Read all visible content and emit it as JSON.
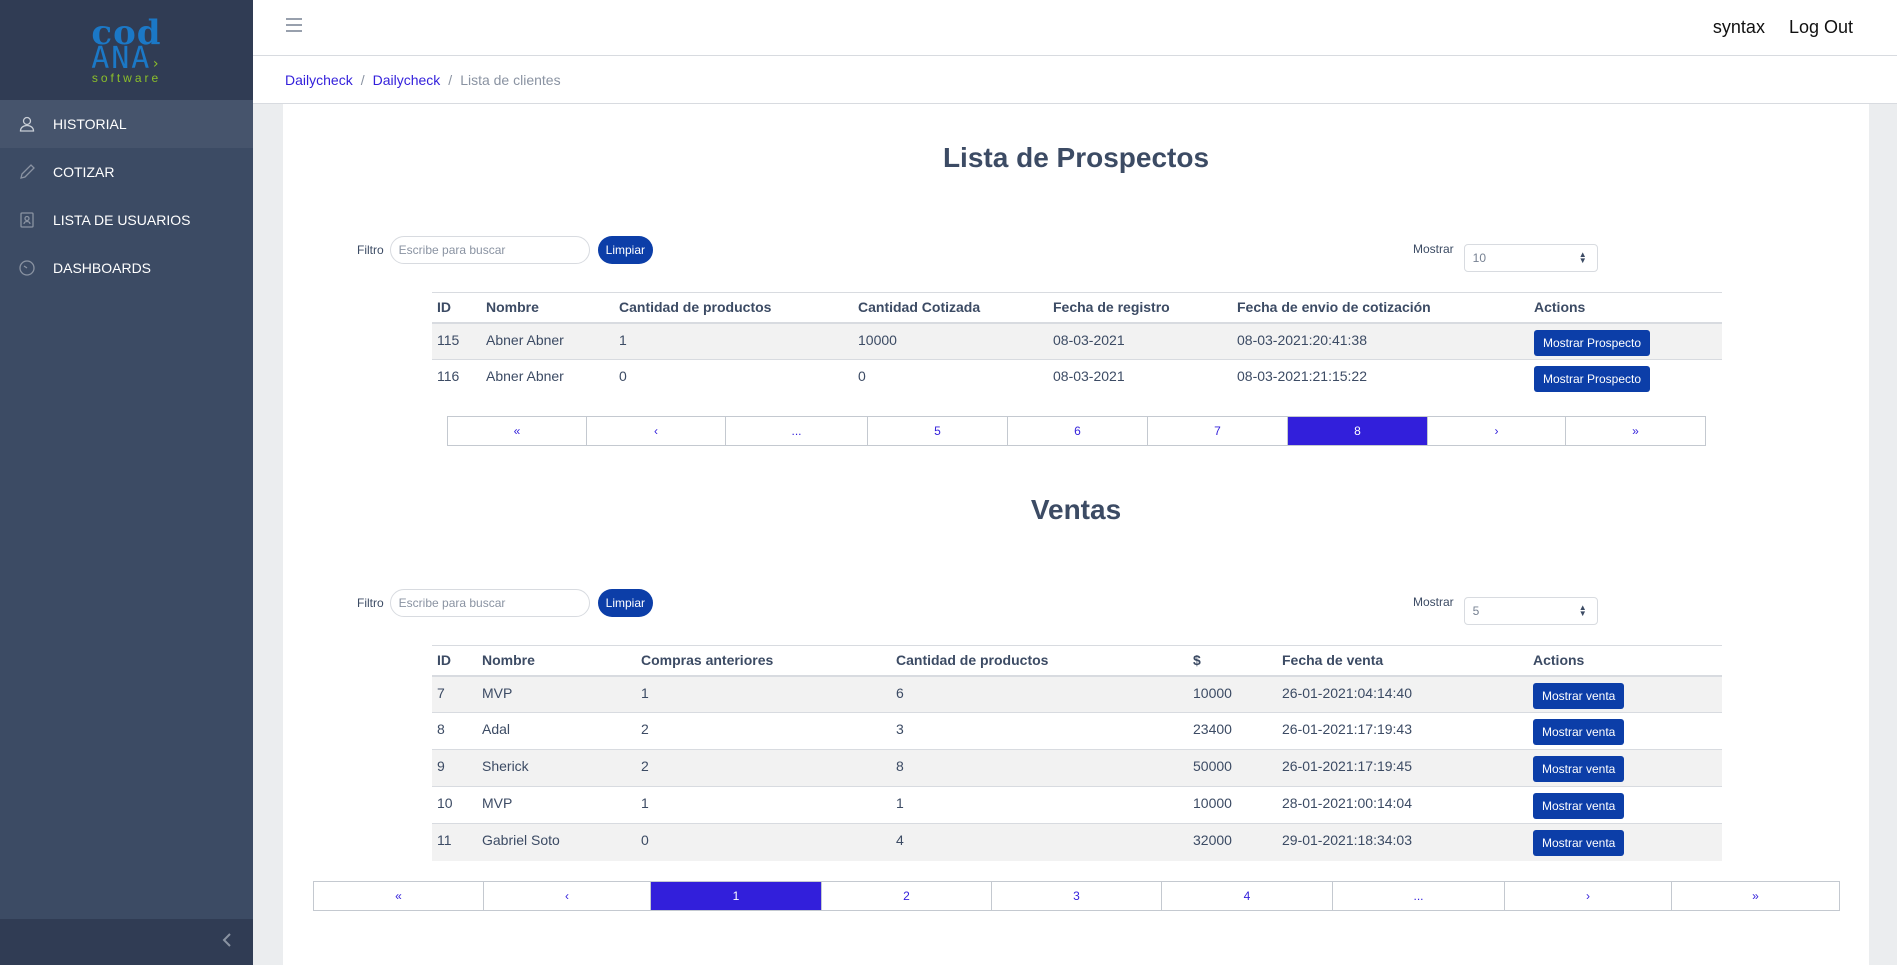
{
  "brand": {
    "line1": "cod",
    "line2": "ANA",
    "line3": "software"
  },
  "sidebar": {
    "items": [
      {
        "label": "HISTORIAL",
        "icon": "user-icon"
      },
      {
        "label": "COTIZAR",
        "icon": "pencil-icon"
      },
      {
        "label": "LISTA DE USUARIOS",
        "icon": "contacts-icon"
      },
      {
        "label": "DASHBOARDS",
        "icon": "speedometer-icon"
      }
    ]
  },
  "header": {
    "user": "syntax",
    "logout": "Log Out"
  },
  "breadcrumb": {
    "c1": "Dailycheck",
    "c2": "Dailycheck",
    "current": "Lista de clientes"
  },
  "prospectos": {
    "title": "Lista de Prospectos",
    "filter_label": "Filtro",
    "filter_placeholder": "Escribe para buscar",
    "clear": "Limpiar",
    "show_label": "Mostrar",
    "show_value": "10",
    "columns": [
      "ID",
      "Nombre",
      "Cantidad de productos",
      "Cantidad Cotizada",
      "Fecha de registro",
      "Fecha de envio de cotización",
      "Actions"
    ],
    "rows": [
      [
        "115",
        "Abner Abner",
        "1",
        "10000",
        "08-03-2021",
        "08-03-2021:20:41:38"
      ],
      [
        "116",
        "Abner Abner",
        "0",
        "0",
        "08-03-2021",
        "08-03-2021:21:15:22"
      ]
    ],
    "action": "Mostrar Prospecto",
    "pages": [
      "«",
      "‹",
      "...",
      "5",
      "6",
      "7",
      "8",
      "›",
      "»"
    ],
    "active_page": "8"
  },
  "ventas": {
    "title": "Ventas",
    "filter_label": "Filtro",
    "filter_placeholder": "Escribe para buscar",
    "clear": "Limpiar",
    "show_label": "Mostrar",
    "show_value": "5",
    "columns": [
      "ID",
      "Nombre",
      "Compras anteriores",
      "Cantidad de productos",
      "$",
      "Fecha de venta",
      "Actions"
    ],
    "rows": [
      [
        "7",
        "MVP",
        "1",
        "6",
        "10000",
        "26-01-2021:04:14:40"
      ],
      [
        "8",
        "Adal",
        "2",
        "3",
        "23400",
        "26-01-2021:17:19:43"
      ],
      [
        "9",
        "Sherick",
        "2",
        "8",
        "50000",
        "26-01-2021:17:19:45"
      ],
      [
        "10",
        "MVP",
        "1",
        "1",
        "10000",
        "28-01-2021:00:14:04"
      ],
      [
        "11",
        "Gabriel Soto",
        "0",
        "4",
        "32000",
        "29-01-2021:18:34:03"
      ]
    ],
    "action": "Mostrar venta",
    "pages": [
      "«",
      "‹",
      "1",
      "2",
      "3",
      "4",
      "...",
      "›",
      "»"
    ],
    "active_page": "1"
  },
  "colors": {
    "sidebar": "#3c4b64",
    "primary": "#321fdb",
    "button": "#0c3ea8"
  }
}
